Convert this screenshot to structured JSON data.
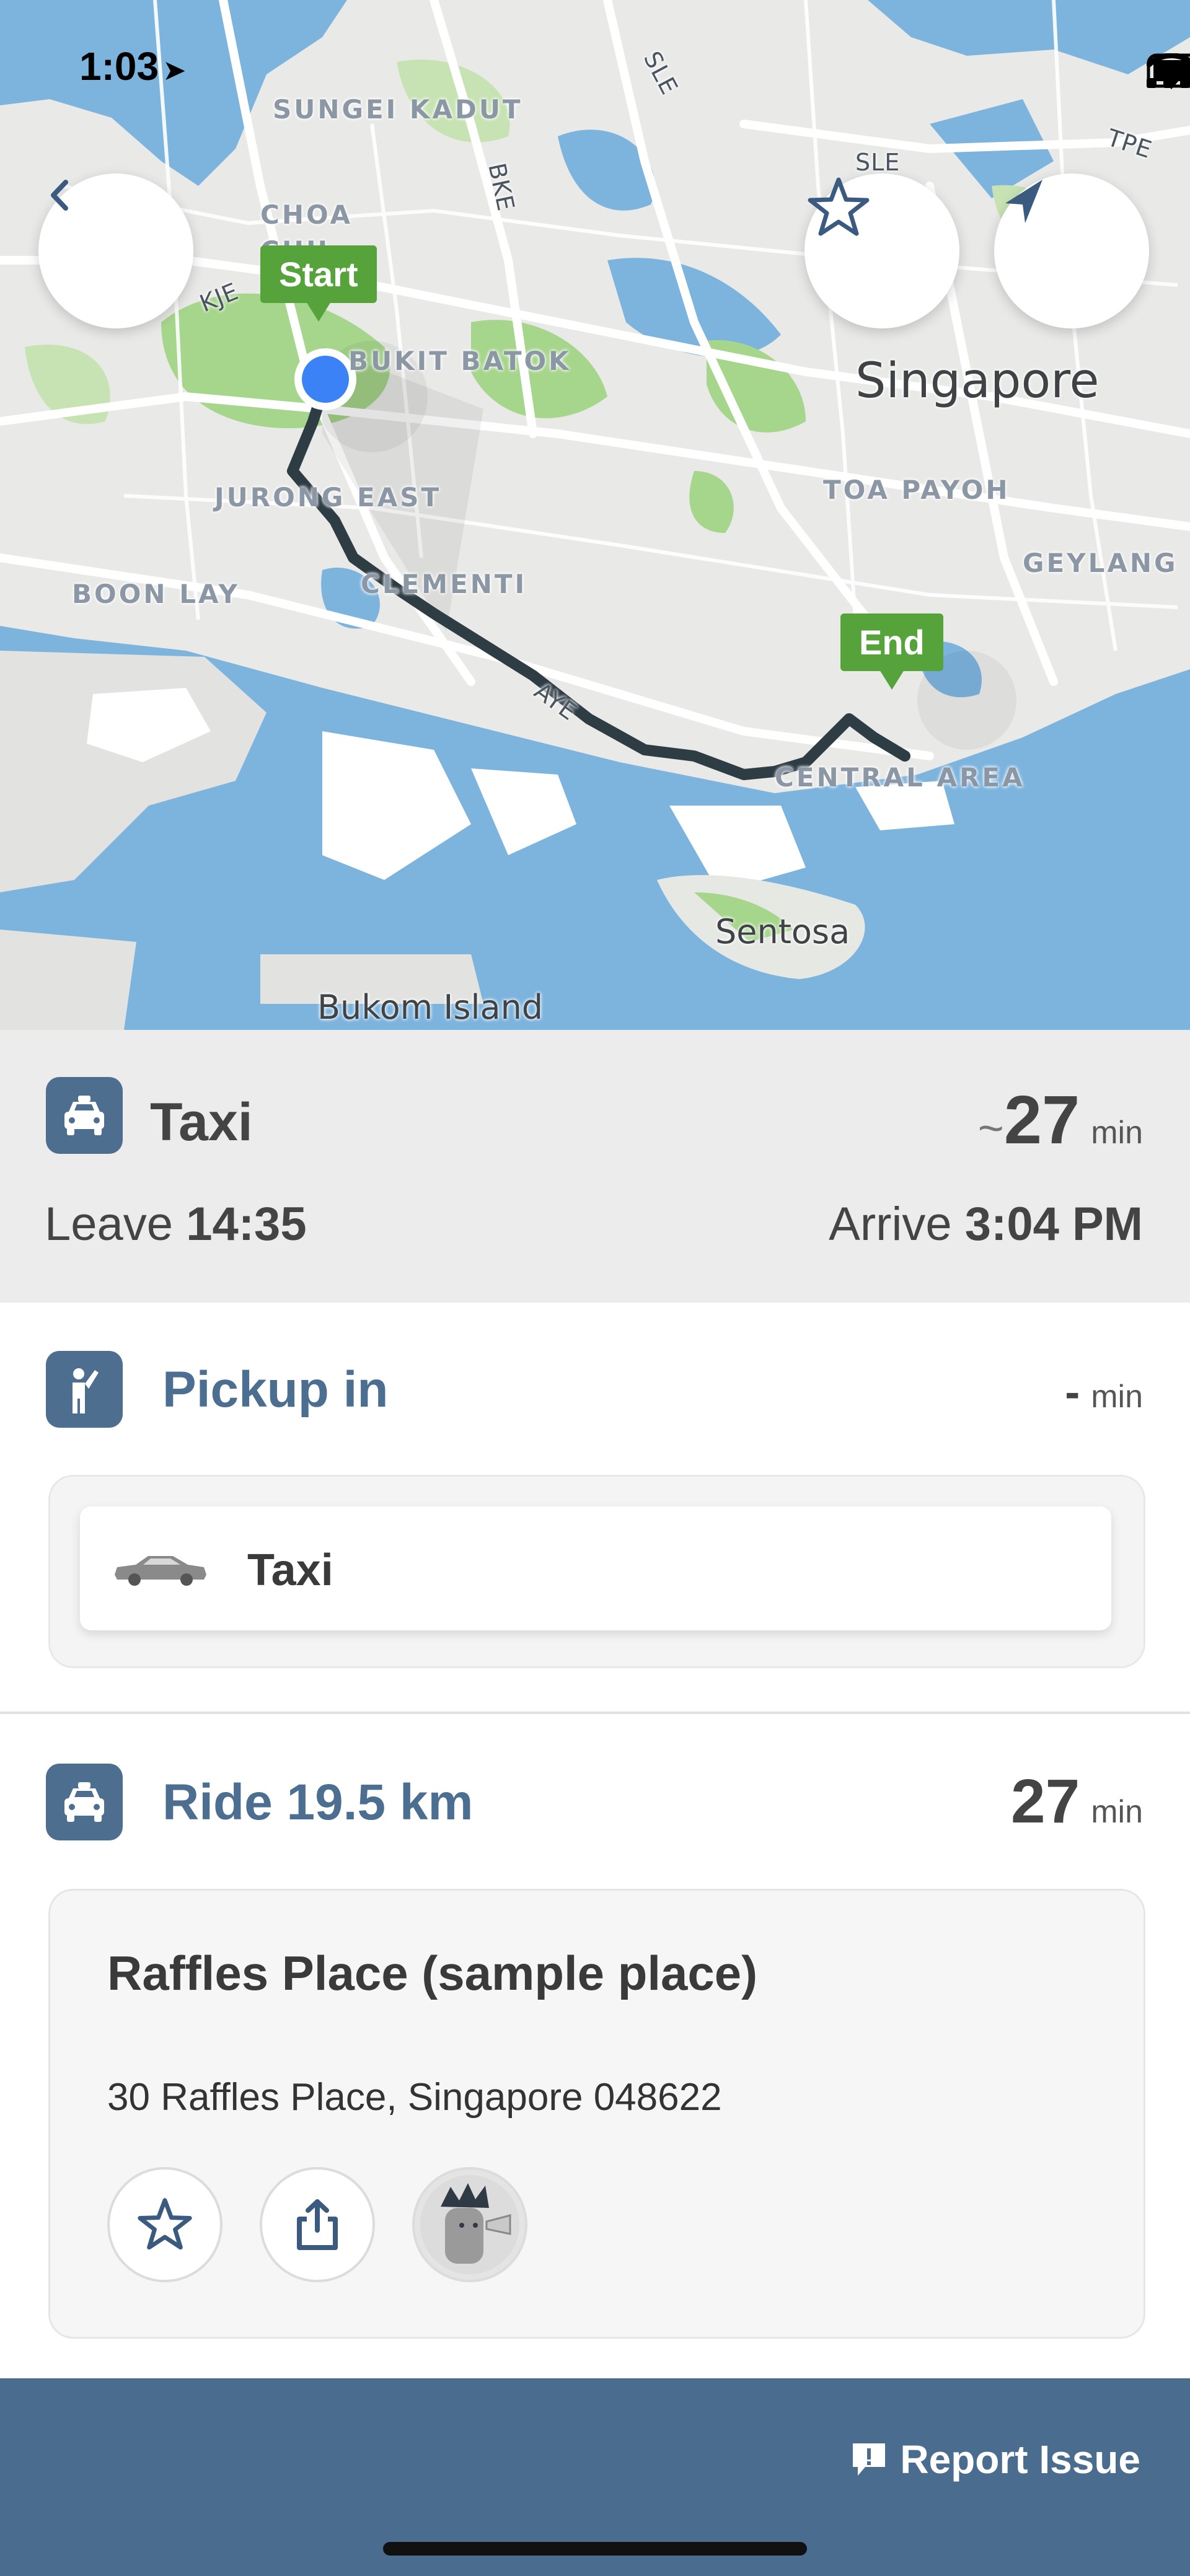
{
  "status_bar": {
    "time": "1:03",
    "location_arrow": "location-arrow-icon"
  },
  "map": {
    "labels": {
      "sungei_kadut": "SUNGEI KADUT",
      "choa_chu_kang": "CHOA CHU KANG",
      "bukit_batok": "BUKIT BATOK",
      "singapore": "Singapore",
      "toa_payoh": "TOA PAYOH",
      "geylang": "GEYLANG",
      "jurong_east": "JURONG EAST",
      "boon_lay": "BOON LAY",
      "clementi": "CLEMENTI",
      "central_area": "CENTRAL AREA",
      "sentosa": "Sentosa",
      "bukom_island": "Bukom Island",
      "road_sle": "SLE",
      "road_sle2": "SLE",
      "road_bke": "BKE",
      "road_kje": "KJE",
      "road_tpe": "TPE",
      "road_aye": "AYE"
    },
    "start_flag": "Start",
    "end_flag": "End"
  },
  "summary": {
    "mode": "Taxi",
    "tilde": "~",
    "duration": "27",
    "duration_unit": "min",
    "leave_label": "Leave",
    "leave_time": "14:35",
    "arrive_label": "Arrive",
    "arrive_time": "3:04 PM"
  },
  "pickup": {
    "title": "Pickup in",
    "duration": "-",
    "duration_unit": "min",
    "option_label": "Taxi"
  },
  "ride": {
    "title": "Ride 19.5 km",
    "duration": "27",
    "duration_unit": "min"
  },
  "place": {
    "name": "Raffles Place (sample place)",
    "address": "30 Raffles Place, Singapore 048622"
  },
  "footer": {
    "report_label": "Report Issue"
  },
  "colors": {
    "accent": "#4b6e91",
    "footer": "#4a6d8f",
    "flag_green": "#55a33a",
    "route": "#2e3c44",
    "water": "#7db4de",
    "park": "#a6d58c"
  }
}
